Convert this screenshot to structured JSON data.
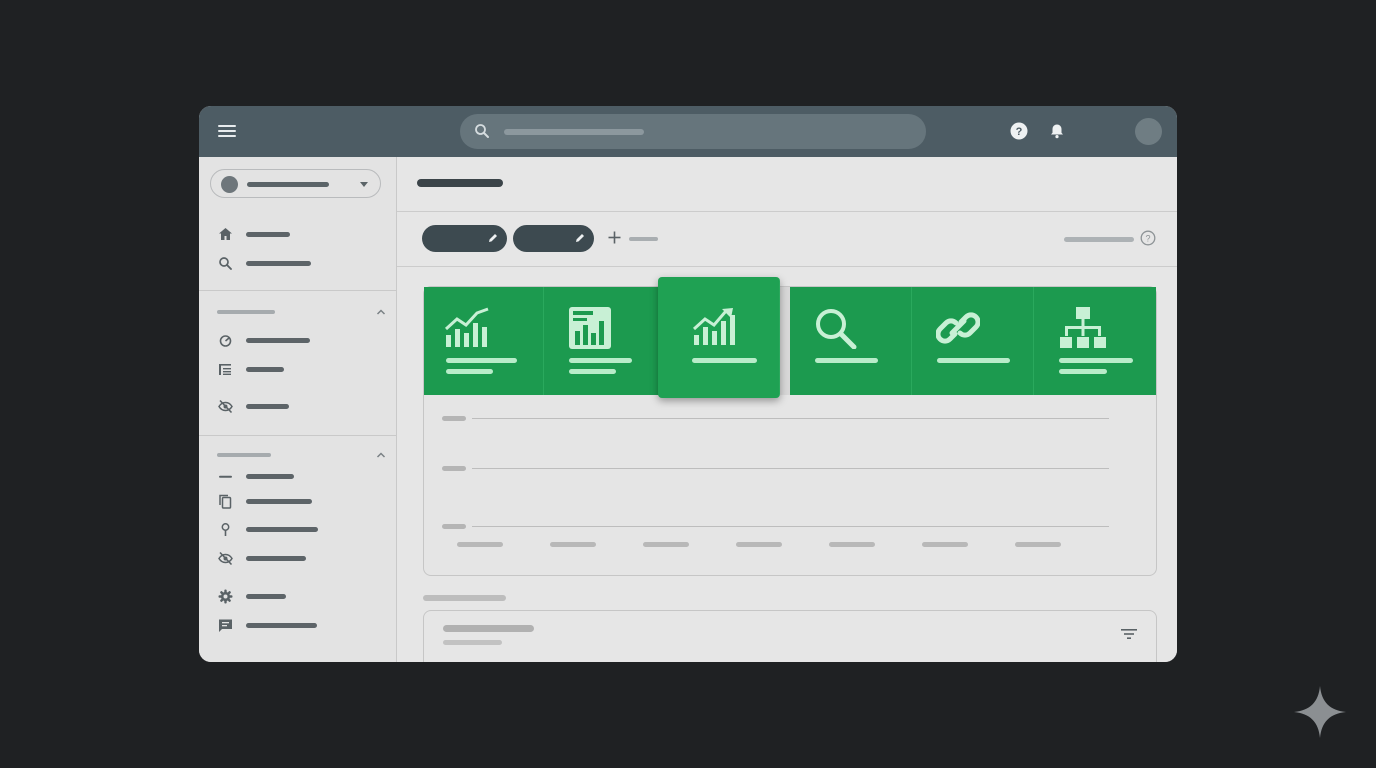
{
  "theme": {
    "background": "#1f2123",
    "topbar": "#4d5c64",
    "accent_green": "#1c9a4f",
    "chip_dark": "#3d4a50"
  },
  "topbar": {
    "menu_icon": "hamburger-menu-icon",
    "search_icon": "search-icon",
    "help_icon": "help-circle-icon",
    "notifications_icon": "bell-icon",
    "avatar": "user-avatar"
  },
  "sidebar": {
    "account_selector_icon": "chevron-down-icon",
    "items_group1": [
      {
        "icon": "home-icon"
      },
      {
        "icon": "search-icon"
      }
    ],
    "items_group2": [
      {
        "icon": "gauge-icon"
      },
      {
        "icon": "list-icon"
      },
      {
        "icon": "eye-off-icon"
      }
    ],
    "items_group3": [
      {
        "icon": "dash-icon"
      },
      {
        "icon": "copy-icon"
      },
      {
        "icon": "location-pin-icon"
      },
      {
        "icon": "eye-off-icon"
      },
      {
        "icon": "gear-icon"
      },
      {
        "icon": "feedback-icon"
      }
    ]
  },
  "main": {
    "chips": [
      {
        "icon": "pencil-icon"
      },
      {
        "icon": "pencil-icon"
      }
    ],
    "add_icon": "plus-icon",
    "help_icon": "help-outline-icon",
    "tiles": [
      {
        "icon": "line-chart-icon"
      },
      {
        "icon": "bar-report-icon"
      },
      {
        "icon": "trend-up-icon",
        "active": true
      },
      {
        "icon": "magnifier-icon"
      },
      {
        "icon": "link-icon"
      },
      {
        "icon": "sitemap-icon"
      }
    ],
    "filter_icon": "filter-icon"
  },
  "watermark": {
    "icon": "sparkle-icon"
  }
}
